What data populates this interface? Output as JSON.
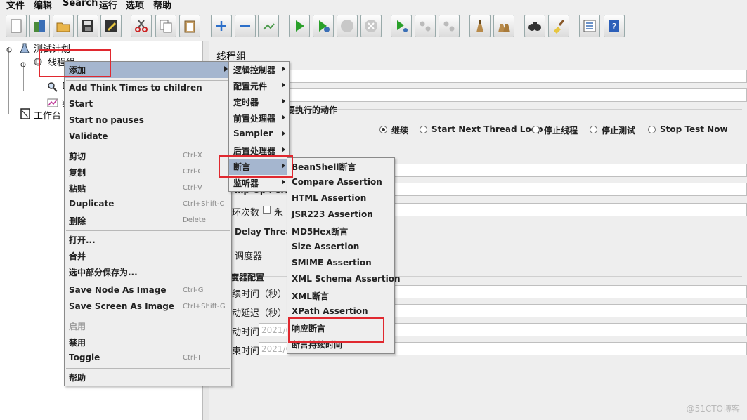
{
  "menubar": {
    "items": [
      "文件",
      "编辑",
      "Search",
      "运行",
      "选项",
      "帮助"
    ]
  },
  "toolbar": {
    "buttons": [
      "new-icon",
      "templates-icon",
      "open-icon",
      "save-icon",
      "save-as-icon",
      "cut-icon",
      "copy-icon",
      "paste-icon",
      "expand-icon",
      "collapse-icon",
      "toggle-icon",
      "start-icon",
      "start-no-pauses-icon",
      "stop-icon",
      "shutdown-icon",
      "remote-start-icon",
      "remote-stop-icon",
      "remote-shutdown-icon",
      "clear-icon",
      "clear-all-icon",
      "search-icon",
      "reset-search-icon",
      "function-helper-icon",
      "help-icon"
    ]
  },
  "tree": {
    "test_plan": "测试计划",
    "thread_group": "线程组",
    "child1_partial": "D",
    "child2_partial": "察",
    "workbench": "工作台"
  },
  "panel": {
    "title": "线程组",
    "error_action_label_partial": "要执行的动作",
    "radios": [
      {
        "label": "继续",
        "checked": true
      },
      {
        "label": "Start Next Thread Loop",
        "checked": false
      },
      {
        "label": "停止线程",
        "checked": false
      },
      {
        "label": "停止测试",
        "checked": false
      },
      {
        "label": "Stop Test Now",
        "checked": false
      }
    ],
    "ramp_partial": "mp-Up Perio",
    "loop_partial": "环次数",
    "forever_partial": "永",
    "delay_partial": "Delay Thread",
    "scheduler_partial": "调度器",
    "scheduler_config_partial": "度器配置",
    "duration_partial": "续时间（秒）",
    "startup_delay_partial": "动延迟（秒）",
    "start_time_partial": "动时间",
    "end_time_partial": "束时间",
    "start_time_value": "2021/0",
    "end_time_value": "2021/0"
  },
  "context_menu": {
    "items": [
      {
        "label": "添加",
        "submenu": true,
        "selected": true
      },
      {
        "label": "Add Think Times to children"
      },
      {
        "label": "Start"
      },
      {
        "label": "Start no pauses"
      },
      {
        "label": "Validate"
      },
      {
        "label": "剪切",
        "shortcut": "Ctrl-X"
      },
      {
        "label": "复制",
        "shortcut": "Ctrl-C"
      },
      {
        "label": "粘贴",
        "shortcut": "Ctrl-V"
      },
      {
        "label": "Duplicate",
        "shortcut": "Ctrl+Shift-C"
      },
      {
        "label": "删除",
        "shortcut": "Delete"
      },
      {
        "label": "打开..."
      },
      {
        "label": "合并"
      },
      {
        "label": "选中部分保存为..."
      },
      {
        "label": "Save Node As Image",
        "shortcut": "Ctrl-G"
      },
      {
        "label": "Save Screen As Image",
        "shortcut": "Ctrl+Shift-G"
      },
      {
        "label": "启用",
        "disabled": true
      },
      {
        "label": "禁用"
      },
      {
        "label": "Toggle",
        "shortcut": "Ctrl-T"
      },
      {
        "label": "帮助"
      }
    ]
  },
  "add_menu": {
    "items": [
      {
        "label": "逻辑控制器"
      },
      {
        "label": "配置元件"
      },
      {
        "label": "定时器"
      },
      {
        "label": "前置处理器"
      },
      {
        "label": "Sampler"
      },
      {
        "label": "后置处理器"
      },
      {
        "label": "断言",
        "selected": true
      },
      {
        "label": "监听器"
      }
    ]
  },
  "assertion_menu": {
    "items": [
      "BeanShell断言",
      "Compare Assertion",
      "HTML Assertion",
      "JSR223 Assertion",
      "MD5Hex断言",
      "Size Assertion",
      "SMIME Assertion",
      "XML Schema Assertion",
      "XML断言",
      "XPath Assertion",
      "响应断言",
      "断言持续时间"
    ]
  },
  "watermark": "@51CTO博客",
  "colors": {
    "highlight": "#a5b6cf",
    "annotation_red": "#e0282f"
  }
}
